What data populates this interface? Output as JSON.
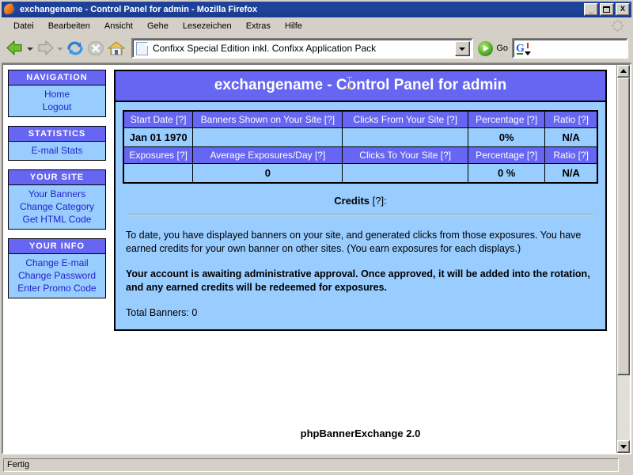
{
  "window": {
    "title": "exchangename - Control Panel for admin - Mozilla Firefox",
    "app_icon": "firefox-icon",
    "minimize_label": "_",
    "maximize_label": "",
    "close_label": "X"
  },
  "menubar": {
    "items": [
      {
        "label": "Datei"
      },
      {
        "label": "Bearbeiten"
      },
      {
        "label": "Ansicht"
      },
      {
        "label": "Gehe"
      },
      {
        "label": "Lesezeichen"
      },
      {
        "label": "Extras"
      },
      {
        "label": "Hilfe"
      }
    ]
  },
  "toolbar": {
    "back_icon": "back-arrow-icon",
    "forward_icon": "forward-arrow-icon",
    "reload_icon": "reload-icon",
    "stop_icon": "stop-icon",
    "home_icon": "home-icon",
    "url_value": "Confixx Special Edition inkl. Confixx Application Pack",
    "url_placeholder": "",
    "go_label": "Go",
    "search_value": "",
    "search_placeholder": "",
    "search_engine_icon": "google-g-icon"
  },
  "sidebar": {
    "sections": [
      {
        "title": "NAVIGATION",
        "links": [
          {
            "label": "Home"
          },
          {
            "label": "Logout"
          }
        ]
      },
      {
        "title": "STATISTICS",
        "links": [
          {
            "label": "E-mail Stats"
          }
        ]
      },
      {
        "title": "YOUR SITE",
        "links": [
          {
            "label": "Your Banners"
          },
          {
            "label": "Change Category"
          },
          {
            "label": "Get HTML Code"
          }
        ]
      },
      {
        "title": "YOUR INFO",
        "links": [
          {
            "label": "Change E-mail"
          },
          {
            "label": "Change Password"
          },
          {
            "label": "Enter Promo Code"
          }
        ]
      }
    ]
  },
  "main": {
    "panel_title": "exchangename - Control Panel for admin",
    "stats_table": {
      "row1_headers": [
        "Start Date [?]",
        "Banners Shown on Your Site [?]",
        "Clicks From Your Site [?]",
        "Percentage [?]",
        "Ratio [?]"
      ],
      "row1_values": [
        "Jan 01 1970",
        "",
        "",
        "0%",
        "N/A"
      ],
      "row2_headers": [
        "Exposures [?]",
        "Average Exposures/Day [?]",
        "Clicks To Your Site [?]",
        "Percentage [?]",
        "Ratio [?]"
      ],
      "row2_values": [
        "",
        "0",
        "",
        "0 %",
        "N/A"
      ]
    },
    "credits_label": "Credits",
    "credits_help": " [?]:",
    "paragraph_1": "To date, you have displayed banners on your site, and generated clicks from those exposures. You have earned credits for your own banner on other sites. (You earn exposures for each displays.)",
    "paragraph_2": "Your account is awaiting administrative approval. Once approved, it will be added into the rotation, and any earned credits will be redeemed for exposures.",
    "total_banners": "Total Banners: 0",
    "footer": "phpBannerExchange 2.0"
  },
  "statusbar": {
    "text": "Fertig"
  },
  "colors": {
    "header_purple": "#6666f2",
    "body_blue": "#99ccff",
    "link_blue": "#2222cc",
    "titlebar_blue": "#1c3f96",
    "chrome_gray": "#d4d0c8"
  }
}
